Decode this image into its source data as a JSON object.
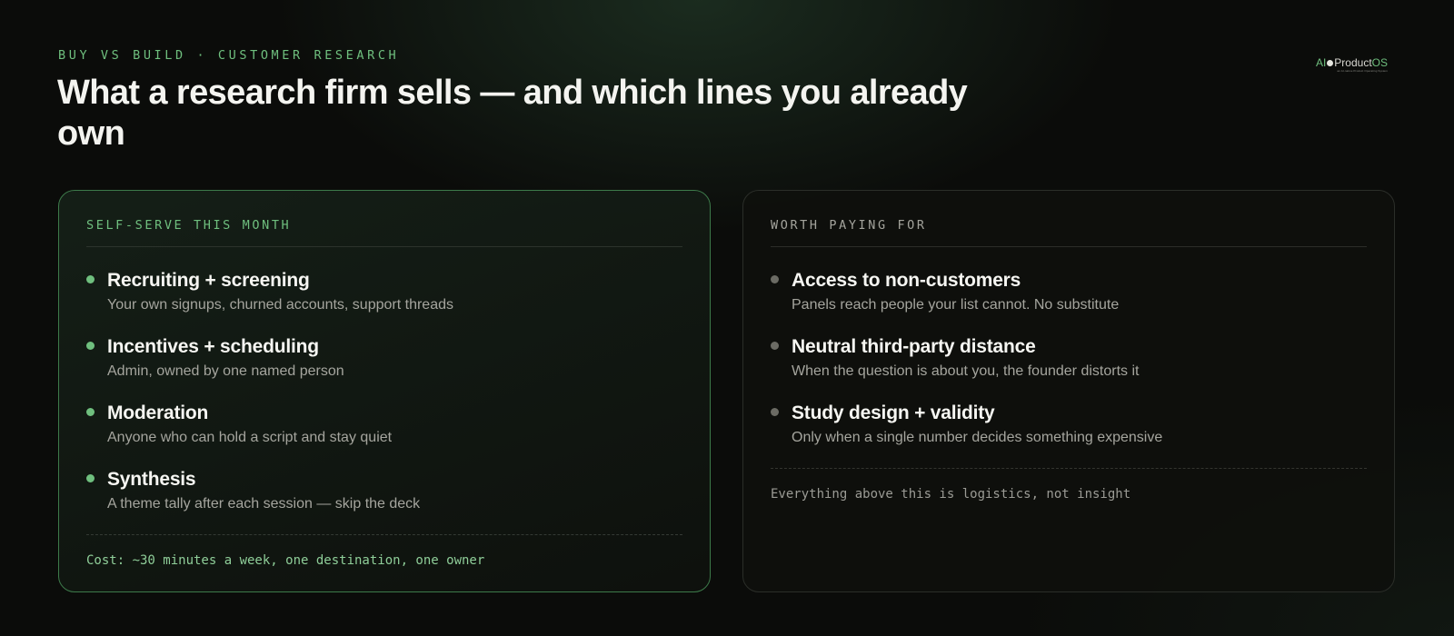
{
  "eyebrow": "BUY VS BUILD · CUSTOMER RESEARCH",
  "title": "What a research firm sells — and which lines you already own",
  "logo": {
    "prefix": "AI",
    "name": "Product",
    "suffix": "OS",
    "tagline": "an AI-native Product Operating System"
  },
  "colors": {
    "accent": "#6fbf7e",
    "background": "#0b0c0a",
    "left_border": "#3d7a4a",
    "muted_bullet": "#6b6b64"
  },
  "left_card": {
    "heading": "SELF-SERVE THIS MONTH",
    "items": [
      {
        "title": "Recruiting + screening",
        "desc": "Your own signups, churned accounts, support threads"
      },
      {
        "title": "Incentives + scheduling",
        "desc": "Admin, owned by one named person"
      },
      {
        "title": "Moderation",
        "desc": "Anyone who can hold a script and stay quiet"
      },
      {
        "title": "Synthesis",
        "desc": "A theme tally after each session — skip the deck"
      }
    ],
    "footer": "Cost: ~30 minutes a week, one destination, one owner"
  },
  "right_card": {
    "heading": "WORTH PAYING FOR",
    "items": [
      {
        "title": "Access to non-customers",
        "desc": "Panels reach people your list cannot. No substitute"
      },
      {
        "title": "Neutral third-party distance",
        "desc": "When the question is about you, the founder distorts it"
      },
      {
        "title": "Study design + validity",
        "desc": "Only when a single number decides something expensive"
      }
    ],
    "footer": "Everything above this is logistics, not insight"
  }
}
